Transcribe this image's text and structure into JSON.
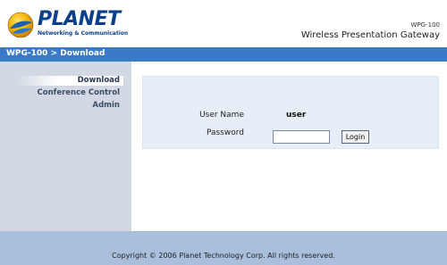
{
  "header": {
    "logo_text": "PLANET",
    "logo_tagline": "Networking & Communication",
    "model": "WPG-100",
    "product_name": "Wireless Presentation Gateway"
  },
  "breadcrumb": "WPG-100 > Download",
  "sidebar": {
    "items": [
      {
        "label": "Download",
        "active": true
      },
      {
        "label": "Conference Control",
        "active": false
      },
      {
        "label": "Admin",
        "active": false
      }
    ]
  },
  "login": {
    "user_label": "User Name",
    "user_value": "user",
    "password_label": "Password",
    "password_value": "",
    "button_label": "Login"
  },
  "footer": {
    "copyright": "Copyright © 2006 Planet Technology Corp. All rights reserved."
  },
  "colors": {
    "brand_blue": "#0a3f8c",
    "breadcrumb_bar": "#3a7bc8",
    "sidebar_bg": "#d2d9e4",
    "panel_bg": "#e8eef8",
    "footer_bg": "#a9bfdc"
  }
}
